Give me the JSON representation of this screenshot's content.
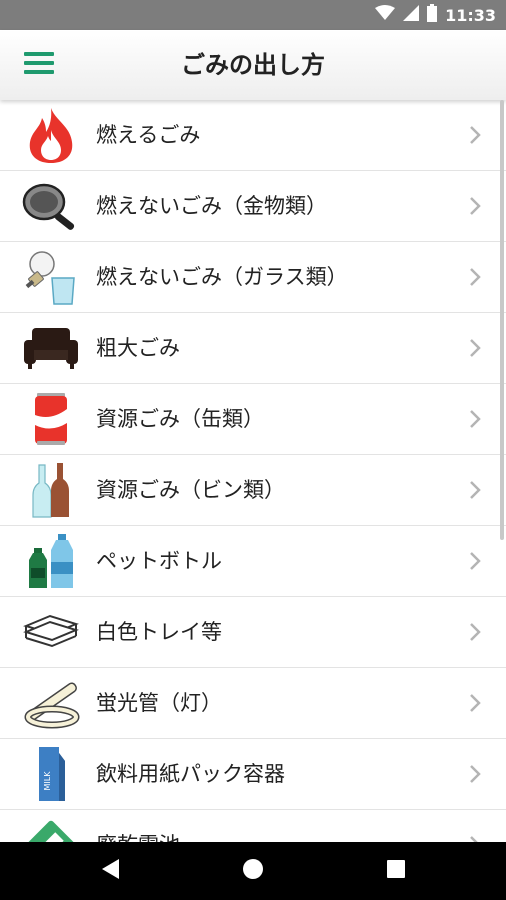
{
  "status_bar": {
    "time": "11:33",
    "icons": [
      "wifi-icon",
      "signal-icon",
      "battery-icon"
    ]
  },
  "app_bar": {
    "title": "ごみの出し方",
    "menu_icon": "hamburger-menu-icon",
    "accent_color": "#1f9a6e"
  },
  "categories": [
    {
      "label": "燃えるごみ",
      "icon": "flame-icon"
    },
    {
      "label": "燃えないごみ（金物類）",
      "icon": "frying-pan-icon"
    },
    {
      "label": "燃えないごみ（ガラス類）",
      "icon": "lightbulb-glass-icon"
    },
    {
      "label": "粗大ごみ",
      "icon": "sofa-icon"
    },
    {
      "label": "資源ごみ（缶類）",
      "icon": "can-icon"
    },
    {
      "label": "資源ごみ（ビン類）",
      "icon": "bottles-icon"
    },
    {
      "label": "ペットボトル",
      "icon": "pet-bottle-icon"
    },
    {
      "label": "白色トレイ等",
      "icon": "tray-icon"
    },
    {
      "label": "蛍光管（灯）",
      "icon": "fluorescent-tube-icon"
    },
    {
      "label": "飲料用紙パック容器",
      "icon": "milk-carton-icon"
    },
    {
      "label": "廃乾電池",
      "icon": "battery-cell-icon"
    }
  ],
  "carton_text": "MILK",
  "nav_bar": {
    "icons": [
      "back-icon",
      "home-icon",
      "recents-icon"
    ]
  }
}
